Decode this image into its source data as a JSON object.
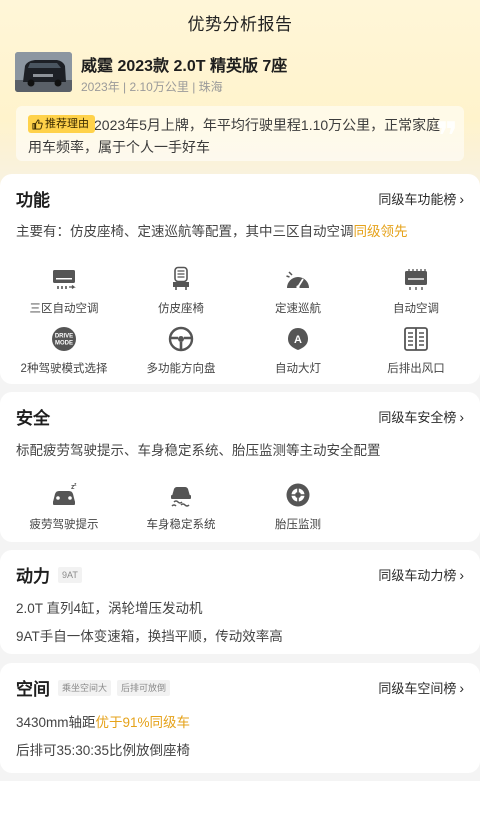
{
  "page_title": "优势分析报告",
  "car": {
    "name": "威霆 2023款 2.0T 精英版 7座",
    "year": "2023年",
    "mileage": "2.10万公里",
    "city": "珠海",
    "sep": " | "
  },
  "recommend": {
    "tag": "推荐理由",
    "text": "2023年5月上牌，年平均行驶里程1.10万公里，正常家庭用车频率，属于个人一手好车"
  },
  "sections": {
    "function": {
      "title": "功能",
      "rank_link": "同级车功能榜",
      "desc_prefix": "主要有：仿皮座椅、定速巡航等配置，其中三区自动空调",
      "desc_highlight": "同级领先",
      "features": [
        {
          "label": "三区自动空调",
          "icon": "air-conditioner-icon"
        },
        {
          "label": "仿皮座椅",
          "icon": "seat-icon"
        },
        {
          "label": "定速巡航",
          "icon": "cruise-control-icon"
        },
        {
          "label": "自动空调",
          "icon": "auto-ac-icon"
        },
        {
          "label": "2种驾驶模式选择",
          "icon": "drive-mode-icon",
          "icon_text": "DRIVE\nMODE"
        },
        {
          "label": "多功能方向盘",
          "icon": "steering-wheel-icon"
        },
        {
          "label": "自动大灯",
          "icon": "auto-headlight-icon",
          "icon_text": "A"
        },
        {
          "label": "后排出风口",
          "icon": "rear-vent-icon"
        }
      ]
    },
    "safety": {
      "title": "安全",
      "rank_link": "同级车安全榜",
      "desc": "标配疲劳驾驶提示、车身稳定系统、胎压监测等主动安全配置",
      "features": [
        {
          "label": "疲劳驾驶提示",
          "icon": "fatigue-driving-icon"
        },
        {
          "label": "车身稳定系统",
          "icon": "stability-control-icon"
        },
        {
          "label": "胎压监测",
          "icon": "tire-pressure-icon"
        }
      ]
    },
    "power": {
      "title": "动力",
      "tags": [
        "9AT"
      ],
      "rank_link": "同级车动力榜",
      "lines": [
        "2.0T 直列4缸，涡轮增压发动机",
        "9AT手自一体变速箱，换挡平顺，传动效率高"
      ]
    },
    "space": {
      "title": "空间",
      "tags": [
        "乘坐空间大",
        "后排可放倒"
      ],
      "rank_link": "同级车空间榜",
      "line1_prefix": "3430mm轴距",
      "line1_highlight": "优于91%同级车",
      "line2": "后排可35:30:35比例放倒座椅"
    }
  },
  "colors": {
    "accent": "#e5a21a",
    "tag_yellow": "#ffd24a",
    "icon_gray": "#555555"
  }
}
